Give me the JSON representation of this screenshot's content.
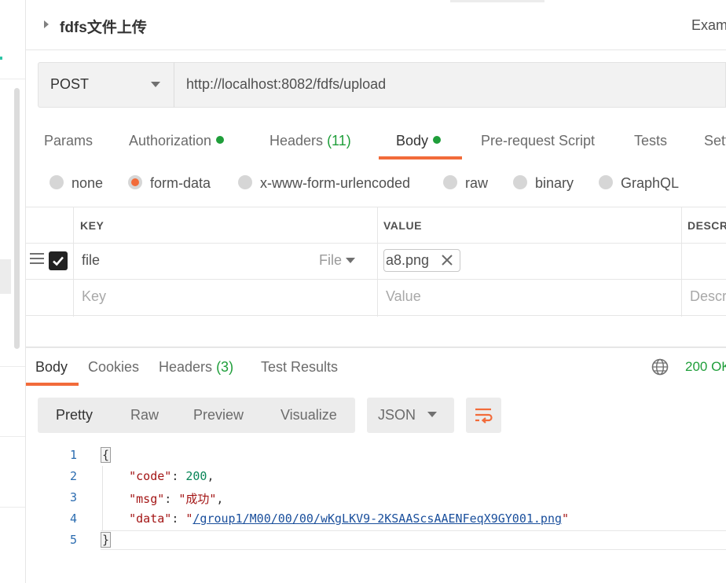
{
  "request": {
    "name": "fdfs文件上传",
    "examples_label": "Exam",
    "method": "POST",
    "url": "http://localhost:8082/fdfs/upload"
  },
  "request_tabs": {
    "params": "Params",
    "authorization": "Authorization",
    "headers": "Headers",
    "headers_count": "(11)",
    "body": "Body",
    "prerequest": "Pre-request Script",
    "tests": "Tests",
    "settings": "Sett"
  },
  "body_types": {
    "none": "none",
    "form_data": "form-data",
    "urlencoded": "x-www-form-urlencoded",
    "raw": "raw",
    "binary": "binary",
    "graphql": "GraphQL",
    "selected": "form-data"
  },
  "kv_table": {
    "headers": {
      "key": "KEY",
      "value": "VALUE",
      "description": "DESCR"
    },
    "rows": [
      {
        "key": "file",
        "type": "File",
        "value": "a8.png",
        "checked": true
      }
    ],
    "placeholders": {
      "key": "Key",
      "value": "Value",
      "description": "Descr"
    }
  },
  "response": {
    "tabs": {
      "body": "Body",
      "cookies": "Cookies",
      "headers": "Headers",
      "headers_count": "(3)",
      "test_results": "Test Results"
    },
    "status": "200 OK",
    "view_modes": [
      "Pretty",
      "Raw",
      "Preview",
      "Visualize"
    ],
    "format": "JSON",
    "line_numbers": [
      "1",
      "2",
      "3",
      "4",
      "5"
    ],
    "json": {
      "open": "{",
      "close": "}",
      "code_key": "\"code\"",
      "code_value": "200",
      "msg_key": "\"msg\"",
      "msg_value": "\"成功\"",
      "data_key": "\"data\"",
      "data_value": "/group1/M00/00/00/wKgLKV9-2KSAAScsAAENFeqX9GY001.png"
    }
  },
  "colors": {
    "accent": "#f26b3a",
    "success": "#1f9e3a",
    "link": "#1a4f9c"
  }
}
